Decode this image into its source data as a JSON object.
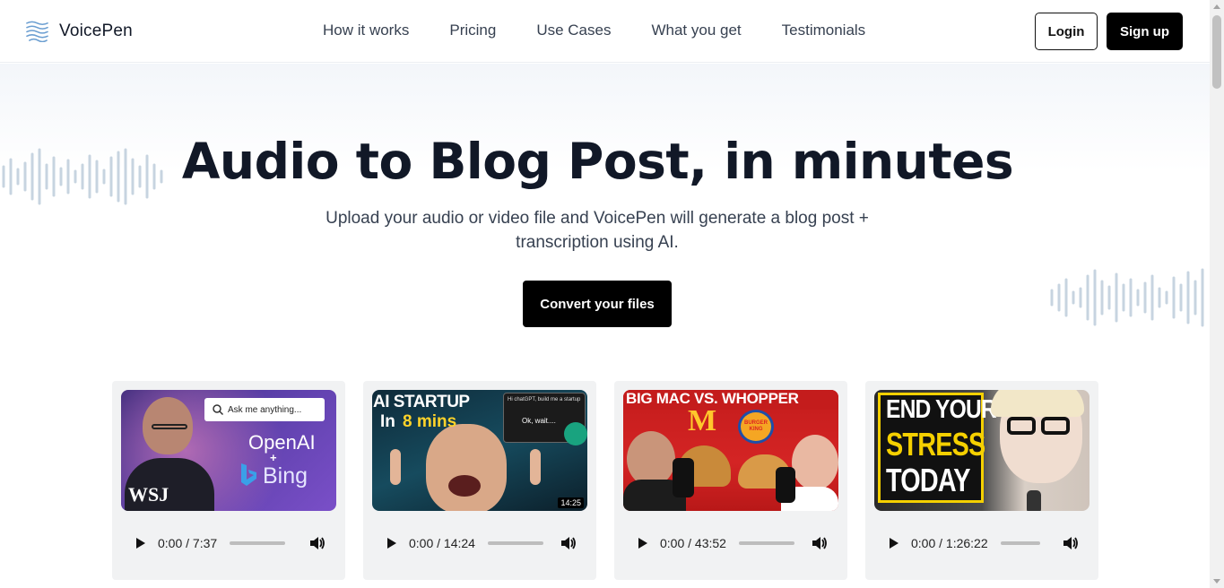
{
  "brand": {
    "name": "VoicePen"
  },
  "nav": {
    "items": [
      "How it works",
      "Pricing",
      "Use Cases",
      "What you get",
      "Testimonials"
    ]
  },
  "auth": {
    "login_label": "Login",
    "signup_label": "Sign up"
  },
  "hero": {
    "title": "Audio to Blog Post, in minutes",
    "subtitle": "Upload your audio or video file and VoicePen will generate a blog post + transcription using AI.",
    "cta_label": "Convert your files"
  },
  "cards": [
    {
      "time": "0:00 / 7:37",
      "thumb_text": {
        "search": "Ask me anything...",
        "brand1": "OpenAI",
        "plus": "+",
        "brand2": "Bing",
        "logo": "WSJ"
      }
    },
    {
      "time": "0:00 / 14:24",
      "thumb_text": {
        "line1": "AI STARTUP",
        "line2a": "In",
        "line2b": "8 mins",
        "chat1": "Hi chatGPT, build me a startup",
        "chat2": "Ok, wait....",
        "duration": "14:25"
      }
    },
    {
      "time": "0:00 / 43:52",
      "thumb_text": {
        "title": "BIG MAC VS. WHOPPER",
        "logo2": "BURGER KING"
      }
    },
    {
      "time": "0:00 / 1:26:22",
      "thumb_text": {
        "line1": "END YOUR",
        "line2": "STRESS",
        "line3": "TODAY"
      }
    }
  ],
  "colors": {
    "primary": "#000000",
    "accent_logo": "#6b9ed1",
    "wave": "#c7d4e0"
  }
}
